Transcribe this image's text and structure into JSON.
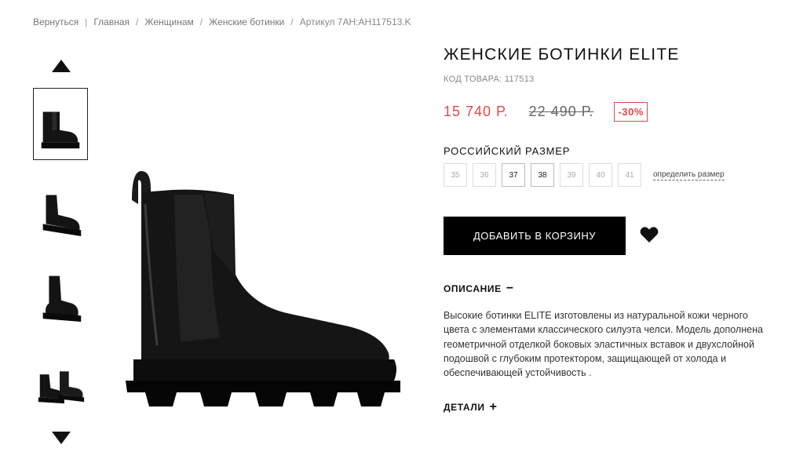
{
  "breadcrumb": {
    "items": [
      "Вернуться",
      "Главная",
      "Женщинам",
      "Женские ботинки"
    ],
    "separators": [
      "|",
      "/",
      "/",
      "/"
    ],
    "current": "Артикул 7AH:AH117513.K"
  },
  "gallery": {
    "thumbnails": [
      {
        "view": "side",
        "active": true
      },
      {
        "view": "three-quarter",
        "active": false
      },
      {
        "view": "front",
        "active": false
      },
      {
        "view": "pair",
        "active": false
      }
    ],
    "up_icon": "triangle-up",
    "down_icon": "triangle-down"
  },
  "product": {
    "title": "ЖЕНСКИЕ БОТИНКИ ELITE",
    "sku": "КОД ТОВАРА: 117513",
    "price_new": "15 740 Р.",
    "price_old": "22 490 Р.",
    "discount": "-30%",
    "size_label": "РОССИЙСКИЙ РАЗМЕР",
    "sizes": [
      {
        "value": "35",
        "available": false
      },
      {
        "value": "36",
        "available": false
      },
      {
        "value": "37",
        "available": true
      },
      {
        "value": "38",
        "available": true
      },
      {
        "value": "39",
        "available": false
      },
      {
        "value": "40",
        "available": false
      },
      {
        "value": "41",
        "available": false
      }
    ],
    "size_guide": "определить размер",
    "add_to_cart": "ДОБАВИТЬ В КОРЗИНУ",
    "wishlist_icon": "heart-icon"
  },
  "description": {
    "heading": "ОПИСАНИЕ",
    "toggle": "−",
    "text": "Высокие ботинки ELITE изготовлены из натуральной кожи черного цвета с элементами классического силуэта челси. Модель дополнена геометричной отделкой боковых эластичных вставок и двухслойной подошвой с глубоким протектором, защищающей от холода и обеспечивающей устойчивость ."
  },
  "details": {
    "heading": "ДЕТАЛИ",
    "toggle": "+"
  },
  "colors": {
    "accent": "#e5474a",
    "button": "#000000"
  }
}
